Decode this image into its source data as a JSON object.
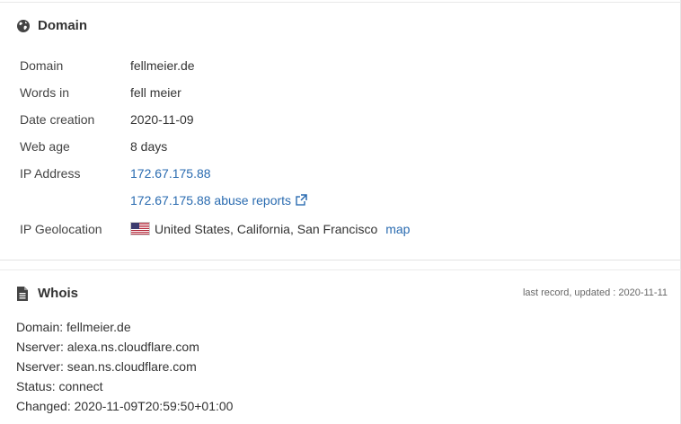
{
  "domain_panel": {
    "title": "Domain",
    "rows": {
      "domain": {
        "label": "Domain",
        "value": "fellmeier.de"
      },
      "words_in": {
        "label": "Words in",
        "value": "fell meier"
      },
      "date_creation": {
        "label": "Date creation",
        "value": "2020-11-09"
      },
      "web_age": {
        "label": "Web age",
        "value": "8 days"
      },
      "ip_address": {
        "label": "IP Address",
        "value": "172.67.175.88"
      },
      "abuse_reports": {
        "value": "172.67.175.88 abuse reports"
      },
      "ip_geolocation": {
        "label": "IP Geolocation",
        "value": "United States, California, San Francisco",
        "map_label": "map"
      }
    }
  },
  "whois_panel": {
    "title": "Whois",
    "last_record": "last record, updated : 2020-11-11",
    "lines": [
      "Domain: fellmeier.de",
      "Nserver: alexa.ns.cloudflare.com",
      "Nserver: sean.ns.cloudflare.com",
      "Status: connect",
      "Changed: 2020-11-09T20:59:50+01:00"
    ]
  },
  "icons": {
    "domain": "globe-icon",
    "whois": "document-icon",
    "abuse": "external-link-icon",
    "flag": "us-flag-icon"
  },
  "colors": {
    "link": "#2a6bb0",
    "text": "#333333"
  }
}
